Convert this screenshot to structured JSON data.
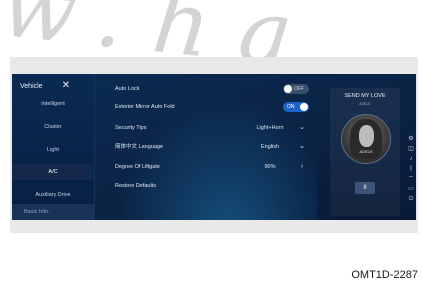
{
  "watermark": "w.ha",
  "sidebar": {
    "title": "Vehicle",
    "close_glyph": "✕",
    "items": [
      {
        "label": "Intelligent"
      },
      {
        "label": "Cluster"
      },
      {
        "label": "Light"
      },
      {
        "label": "A/C"
      },
      {
        "label": "Auxiliary Drive"
      }
    ],
    "bottom_label": "Basic Info."
  },
  "settings": {
    "auto_lock": {
      "label": "Auto Lock",
      "state": "OFF"
    },
    "mirror_fold": {
      "label": "Exterior Mirror Auto Fold",
      "state": "ON"
    },
    "security_tips": {
      "label": "Security Tips",
      "value": "Light+Horn",
      "chevron": "⌄"
    },
    "language": {
      "label": "简体中文 Language",
      "value": "English",
      "chevron": "⌄"
    },
    "liftgate": {
      "label": "Degree Of Liftgate",
      "value": "90%",
      "chevron": "›"
    },
    "restore": {
      "label": "Restore Defaults"
    }
  },
  "media": {
    "title": "SEND MY LOVE",
    "artist": "ADELE",
    "album_text": "ADELE",
    "pause_glyph": "II"
  },
  "side_icons": [
    "settings-icon",
    "car-icon",
    "sound-icon",
    "bluetooth-icon",
    "wifi-icon",
    "display-icon",
    "power-icon"
  ],
  "figure_code": "OMT1D-2287"
}
